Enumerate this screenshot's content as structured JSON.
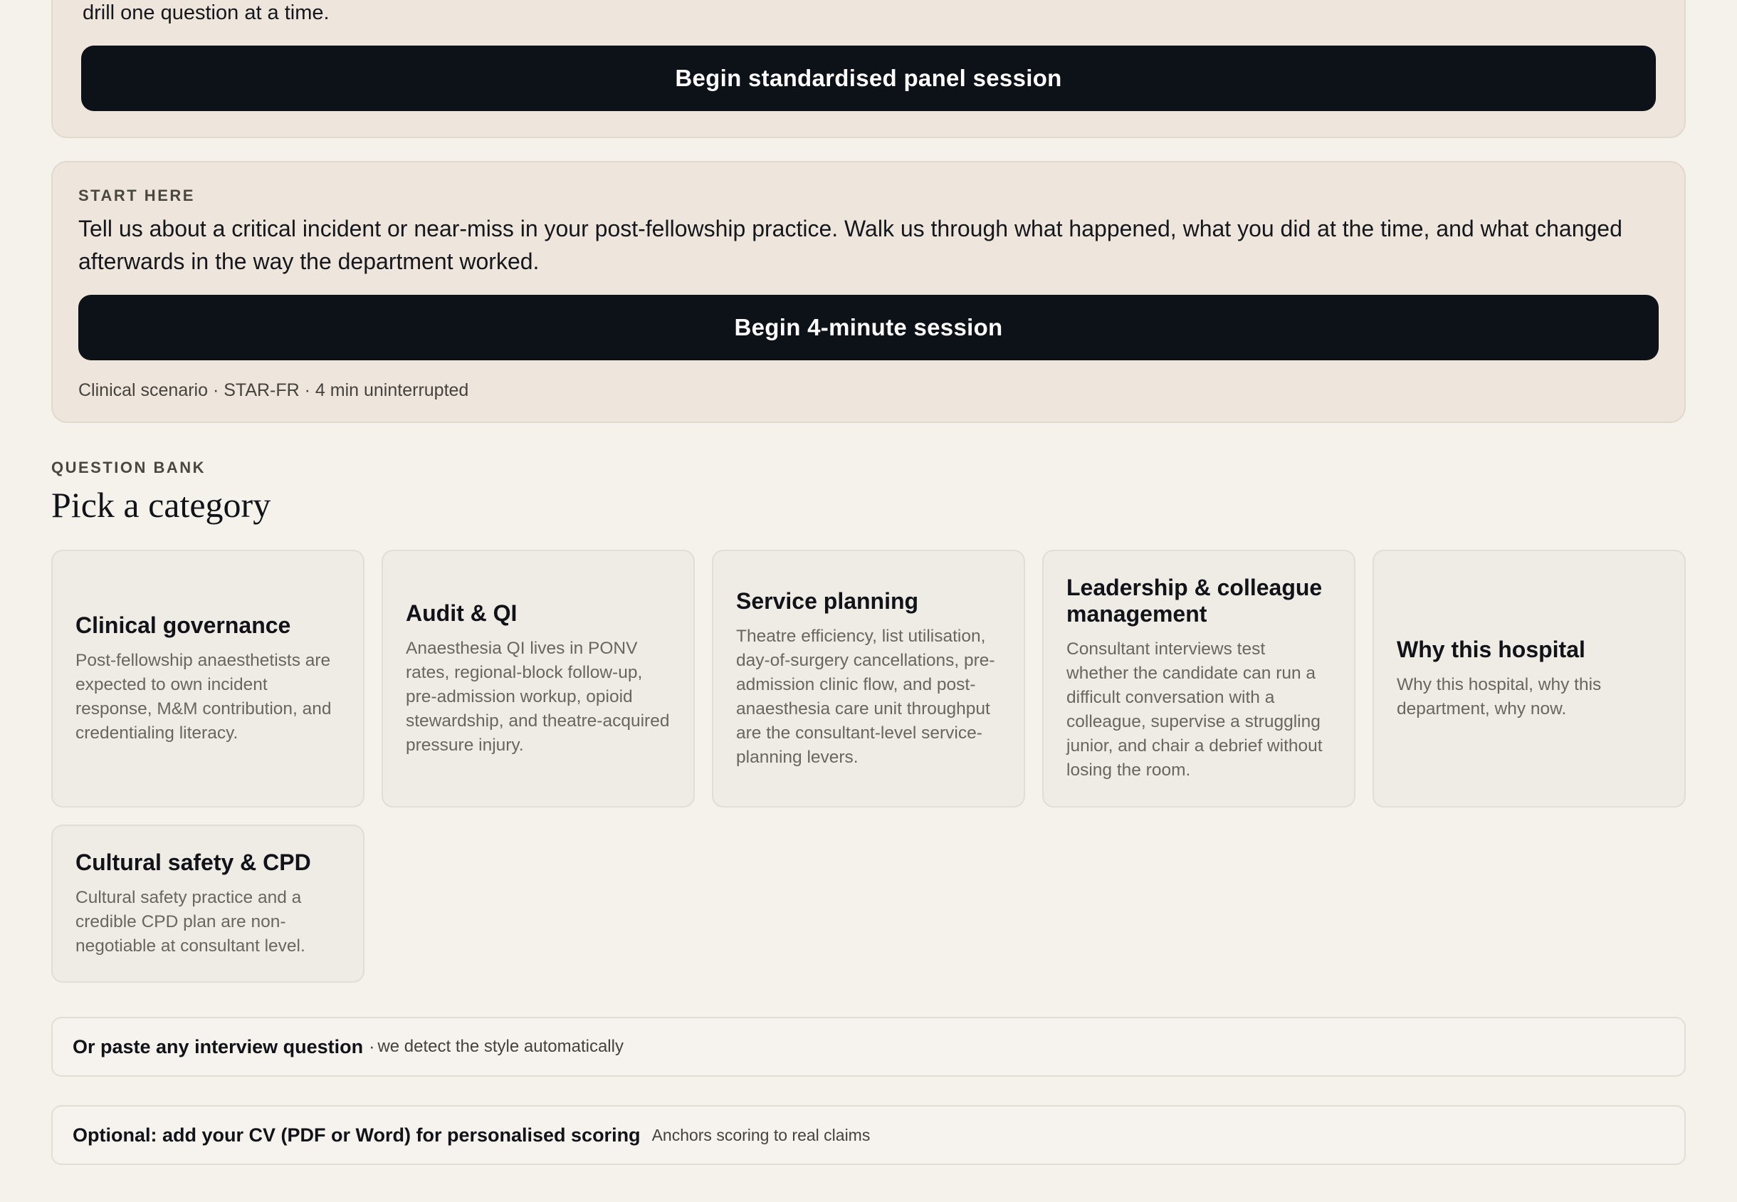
{
  "top_card": {
    "intro_text": "drill one question at a time.",
    "button_label": "Begin standardised panel session"
  },
  "start_card": {
    "eyebrow": "START HERE",
    "question": "Tell us about a critical incident or near-miss in your post-fellowship practice. Walk us through what happened, what you did at the time, and what changed afterwards in the way the department worked.",
    "button_label": "Begin 4-minute session",
    "meta": "Clinical scenario · STAR-FR · 4 min uninterrupted"
  },
  "bank": {
    "eyebrow": "QUESTION BANK",
    "title": "Pick a category",
    "categories": [
      {
        "title": "Clinical governance",
        "description": "Post-fellowship anaesthetists are expected to own incident response, M&M contribution, and credentialing literacy."
      },
      {
        "title": "Audit & QI",
        "description": "Anaesthesia QI lives in PONV rates, regional-block follow-up, pre-admission workup, opioid stewardship, and theatre-acquired pressure injury."
      },
      {
        "title": "Service planning",
        "description": "Theatre efficiency, list utilisation, day-of-surgery cancellations, pre-admission clinic flow, and post-anaesthesia care unit throughput are the consultant-level service-planning levers."
      },
      {
        "title": "Leadership & colleague management",
        "description": "Consultant interviews test whether the candidate can run a difficult conversation with a colleague, supervise a struggling junior, and chair a debrief without losing the room."
      },
      {
        "title": "Why this hospital",
        "description": "Why this hospital, why this department, why now."
      },
      {
        "title": "Cultural safety & CPD",
        "description": "Cultural safety practice and a credible CPD plan are non-negotiable at consultant level."
      }
    ]
  },
  "paste_bar": {
    "label": "Or paste any interview question",
    "separator": "·",
    "hint": "we detect the style automatically"
  },
  "cv_bar": {
    "label": "Optional: add your CV (PDF or Word) for personalised scoring",
    "hint": "Anchors scoring to real claims"
  }
}
